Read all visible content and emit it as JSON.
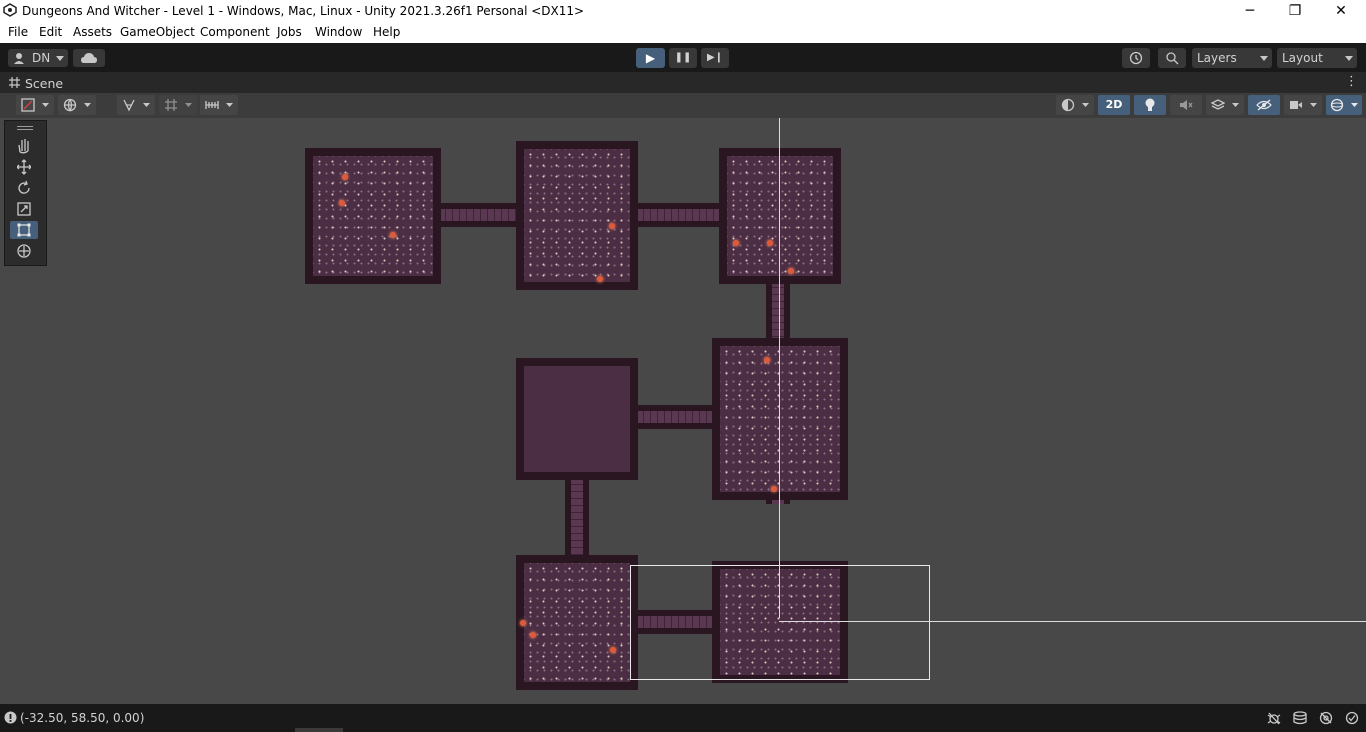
{
  "window": {
    "title": "Dungeons And Witcher - Level 1 - Windows, Mac, Linux - Unity 2021.3.26f1 Personal <DX11>",
    "controls": [
      "─",
      "❐",
      "✕"
    ]
  },
  "menu": [
    "File",
    "Edit",
    "Assets",
    "GameObject",
    "Component",
    "Jobs",
    "Window",
    "Help"
  ],
  "toolbar": {
    "account_label": "DN",
    "layers_label": "Layers",
    "layout_label": "Layout",
    "play_glyph": "▶",
    "pause_glyph": "❚❚",
    "step_glyph": "▶❙"
  },
  "scene": {
    "tab_label": "Scene",
    "mode_2d_label": "2D",
    "more_glyph": "⋮"
  },
  "status": {
    "coordinates": "(-32.50, 58.50, 0.00)"
  },
  "colors": {
    "accent": "#46607c",
    "room_wall": "#2a1620",
    "room_floor": "#4c2e44",
    "torch": "#e05a3a"
  }
}
